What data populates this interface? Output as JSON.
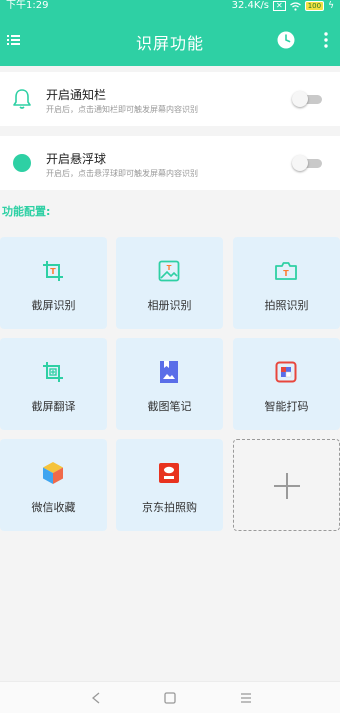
{
  "status_bar": {
    "time": "下午1:29",
    "speed": "32.4K/s",
    "battery": "100"
  },
  "app_bar": {
    "title": "识屏功能",
    "menu_icon": "menu-icon",
    "clock_icon": "clock-icon",
    "more_icon": "more-vert-icon"
  },
  "settings": [
    {
      "title": "开启通知栏",
      "desc": "开启后，点击通知栏即可触发屏幕内容识别",
      "enabled": false,
      "icon": "bell-icon"
    },
    {
      "title": "开启悬浮球",
      "desc": "开启后，点击悬浮球即可触发屏幕内容识别",
      "enabled": false,
      "icon": "floating-ball-icon"
    }
  ],
  "section_label": "功能配置:",
  "functions": [
    {
      "label": "截屏识别",
      "icon": "crop-text-icon"
    },
    {
      "label": "相册识别",
      "icon": "album-icon"
    },
    {
      "label": "拍照识别",
      "icon": "camera-text-icon"
    },
    {
      "label": "截屏翻译",
      "icon": "crop-translate-icon"
    },
    {
      "label": "截图笔记",
      "icon": "note-icon"
    },
    {
      "label": "智能打码",
      "icon": "mosaic-icon"
    },
    {
      "label": "微信收藏",
      "icon": "wechat-favorites-icon"
    },
    {
      "label": "京东拍照购",
      "icon": "jd-photo-shop-icon"
    }
  ],
  "add_tile_icon": "plus-icon",
  "colors": {
    "accent": "#2ed0a4",
    "tile_bg": "#e2f1fb",
    "icon_orange": "#ff7a2e",
    "icon_blue": "#5a6ee8"
  },
  "nav_bar": {
    "back_icon": "back-icon",
    "home_icon": "home-icon",
    "recents_icon": "recents-icon"
  }
}
